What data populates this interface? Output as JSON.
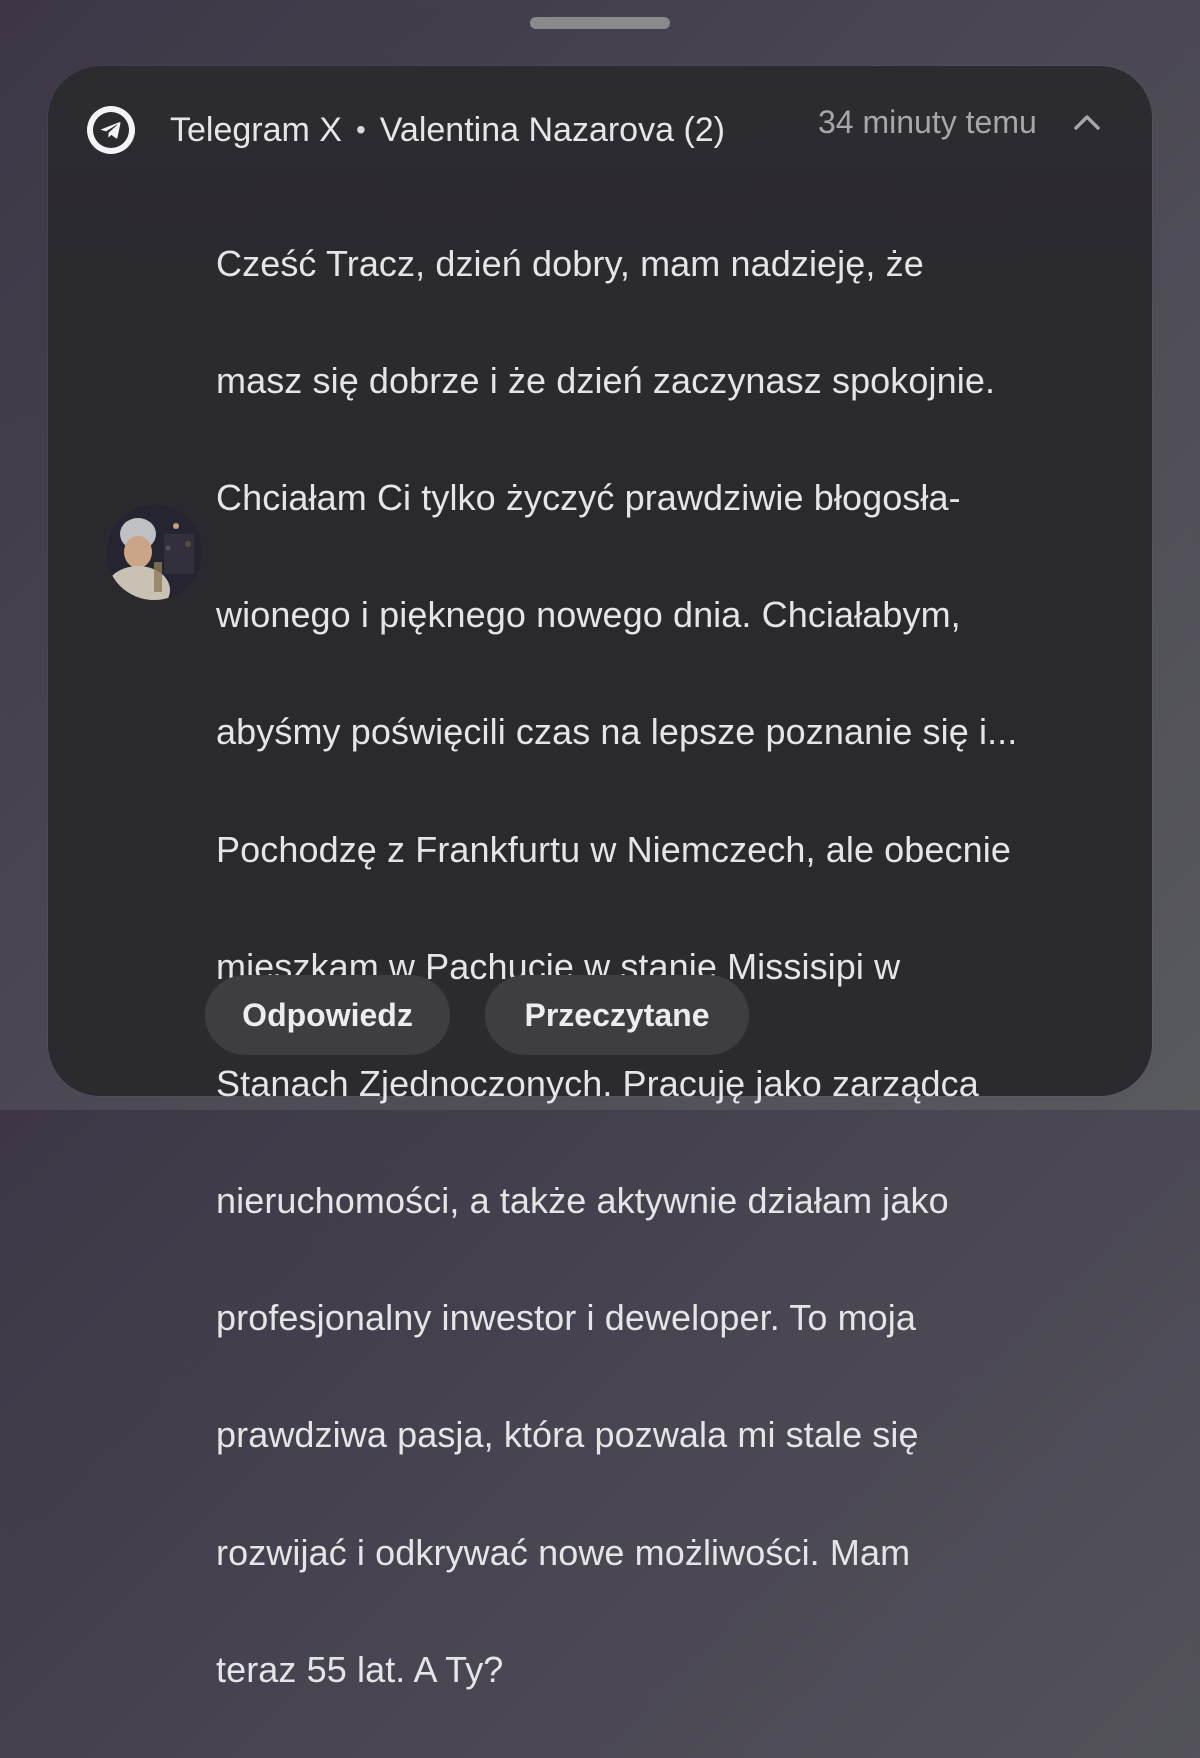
{
  "notification": {
    "app_name": "Telegram X",
    "separator": "•",
    "sender": "Valentina Nazarova (2)",
    "timestamp": "34 minuty temu",
    "message_lines": [
      "Cześć Tracz, dzień dobry, mam nadzieję, że",
      "masz się dobrze i że dzień zaczynasz spokojnie.",
      "Chciałam Ci tylko życzyć prawdziwie błogosła-",
      "wionego i pięknego nowego dnia. Chciałabym,",
      "abyśmy poświęcili czas na lepsze poznanie się i...",
      "Pochodzę z Frankfurtu w Niemczech, ale obecnie",
      "mieszkam w Pachucie w stanie Missisipi w",
      "Stanach Zjednoczonych. Pracuję jako zarządca",
      "nieruchomości, a także aktywnie działam jako",
      "profesjonalny inwestor i deweloper. To moja",
      "prawdziwa pasja, która pozwala mi stale się",
      "rozwijać i odkrywać nowe możliwości. Mam",
      "teraz 55 lat. A Ty?"
    ],
    "actions": {
      "reply_label": "Odpowiedz",
      "mark_read_label": "Przeczytane"
    }
  },
  "icons": {
    "app": "telegram-icon",
    "expand": "chevron-up-icon",
    "sender_avatar": "avatar"
  },
  "colors": {
    "card_background": "#2b2a2f",
    "button_background": "#3e3d42",
    "primary_text": "#e5e5e7",
    "secondary_text": "#a7a7ab"
  }
}
